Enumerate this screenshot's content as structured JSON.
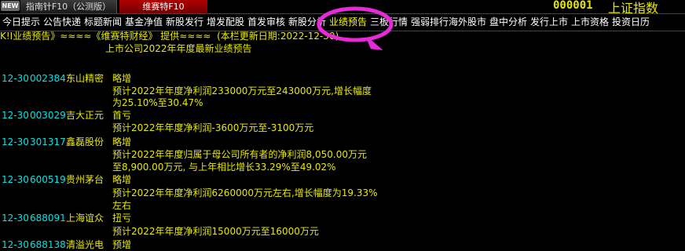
{
  "topbar": {
    "new_badge": "NEW",
    "tabs": [
      {
        "label": "指南针F10（公测版）"
      },
      {
        "label": "维赛特F10"
      }
    ],
    "stock_code": "000001",
    "index_name": "上证指数"
  },
  "nav": {
    "items": [
      {
        "label": "今日提示"
      },
      {
        "label": "公告快递"
      },
      {
        "label": "标题新闻"
      },
      {
        "label": "基金净值"
      },
      {
        "label": "新股发行"
      },
      {
        "label": "增发配股"
      },
      {
        "label": "首发审核"
      },
      {
        "label": "新股分析"
      },
      {
        "label": "业绩预告"
      },
      {
        "label": "三板行情"
      },
      {
        "label": "强弱排行"
      },
      {
        "label": "海外股市"
      },
      {
        "label": "盘中分析"
      },
      {
        "label": "发行上市"
      },
      {
        "label": "上市资格"
      },
      {
        "label": "投资日历"
      }
    ],
    "active_index": 8
  },
  "content": {
    "header_line": "K!I业绩预告》≈≈≈≈《维赛特财经》 提供≈≈≈≈  (本栏更新日期:2022-12-30)",
    "subtitle": "上市公司2022年年度最新业绩预告",
    "records": [
      {
        "date": "12-30",
        "code": "002384",
        "name": "东山精密",
        "type": "略增",
        "lines": [
          "预计2022年年度净利润233000万元至243000万元,增长幅度",
          "为25.10%至30.47%"
        ]
      },
      {
        "date": "12-30",
        "code": "003029",
        "name": "吉大正元",
        "type": "首亏",
        "lines": [
          "预计2022年年度净利润-3600万元至-3100万元"
        ]
      },
      {
        "date": "12-30",
        "code": "301317",
        "name": "鑫磊股份",
        "type": "略增",
        "lines": [
          "预计2022年年度归属于母公司所有者的净利润8,050.00万元",
          "至8,900.00万元, 与上年相比增长33.29%至49.02%"
        ]
      },
      {
        "date": "12-30",
        "code": "600519",
        "name": "贵州茅台",
        "type": "略增",
        "lines": [
          "预计2022年年度净利润6260000万元左右,增长幅度为19.33%",
          "左右"
        ]
      },
      {
        "date": "12-30",
        "code": "688091",
        "name": "上海谊众",
        "type": "扭亏",
        "lines": [
          "预计2022年年度净利润15000万元至16000万元"
        ]
      },
      {
        "date": "12-30",
        "code": "688138",
        "name": "清溢光电",
        "type": "预增",
        "lines": []
      }
    ]
  },
  "colors": {
    "background": "#000000",
    "text_yellow": "#e8e800",
    "text_cyan": "#00e5e5",
    "active_tab": "#ffff00",
    "annotation_magenta": "#e62ad8"
  }
}
